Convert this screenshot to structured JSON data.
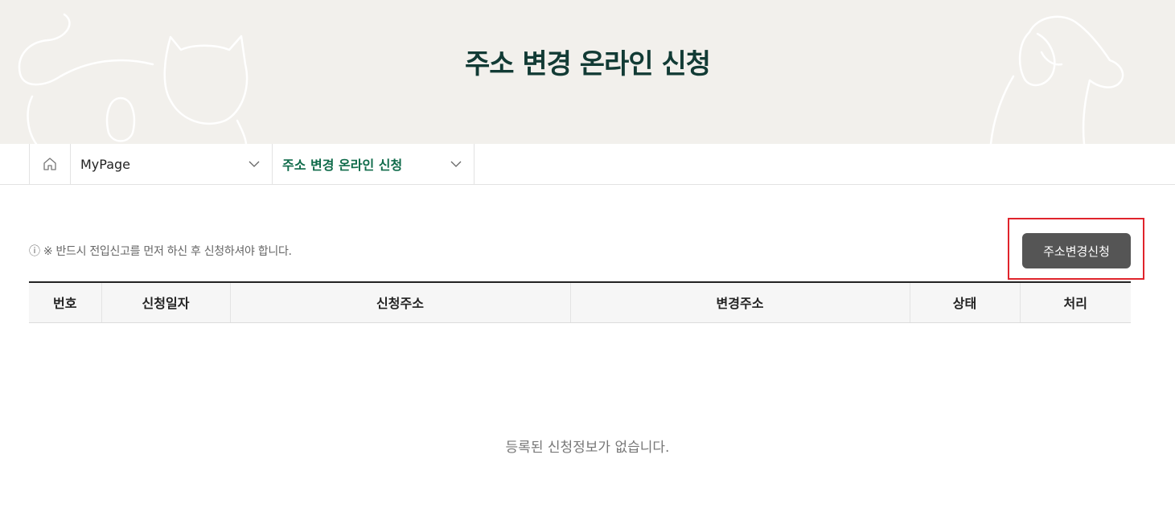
{
  "header": {
    "title": "주소 변경 온라인 신청"
  },
  "breadcrumb": {
    "home_icon": "home-icon",
    "items": [
      {
        "label": "MyPage",
        "icon": "chevron-down-icon"
      },
      {
        "label": "주소 변경 온라인 신청",
        "icon": "chevron-down-icon"
      }
    ]
  },
  "notice": {
    "icon": "info-icon",
    "text": "※ 반드시 전입신고를 먼저 하신 후 신청하셔야 합니다."
  },
  "actions": {
    "apply_label": "주소변경신청"
  },
  "table": {
    "columns": [
      "번호",
      "신청일자",
      "신청주소",
      "변경주소",
      "상태",
      "처리"
    ],
    "rows": [],
    "empty_text": "등록된 신청정보가 없습니다."
  },
  "colors": {
    "hero_bg": "#f2f0ec",
    "title": "#123b35",
    "active_breadcrumb": "#0f6b4a",
    "button_bg": "#555555",
    "highlight": "#e0242c"
  }
}
